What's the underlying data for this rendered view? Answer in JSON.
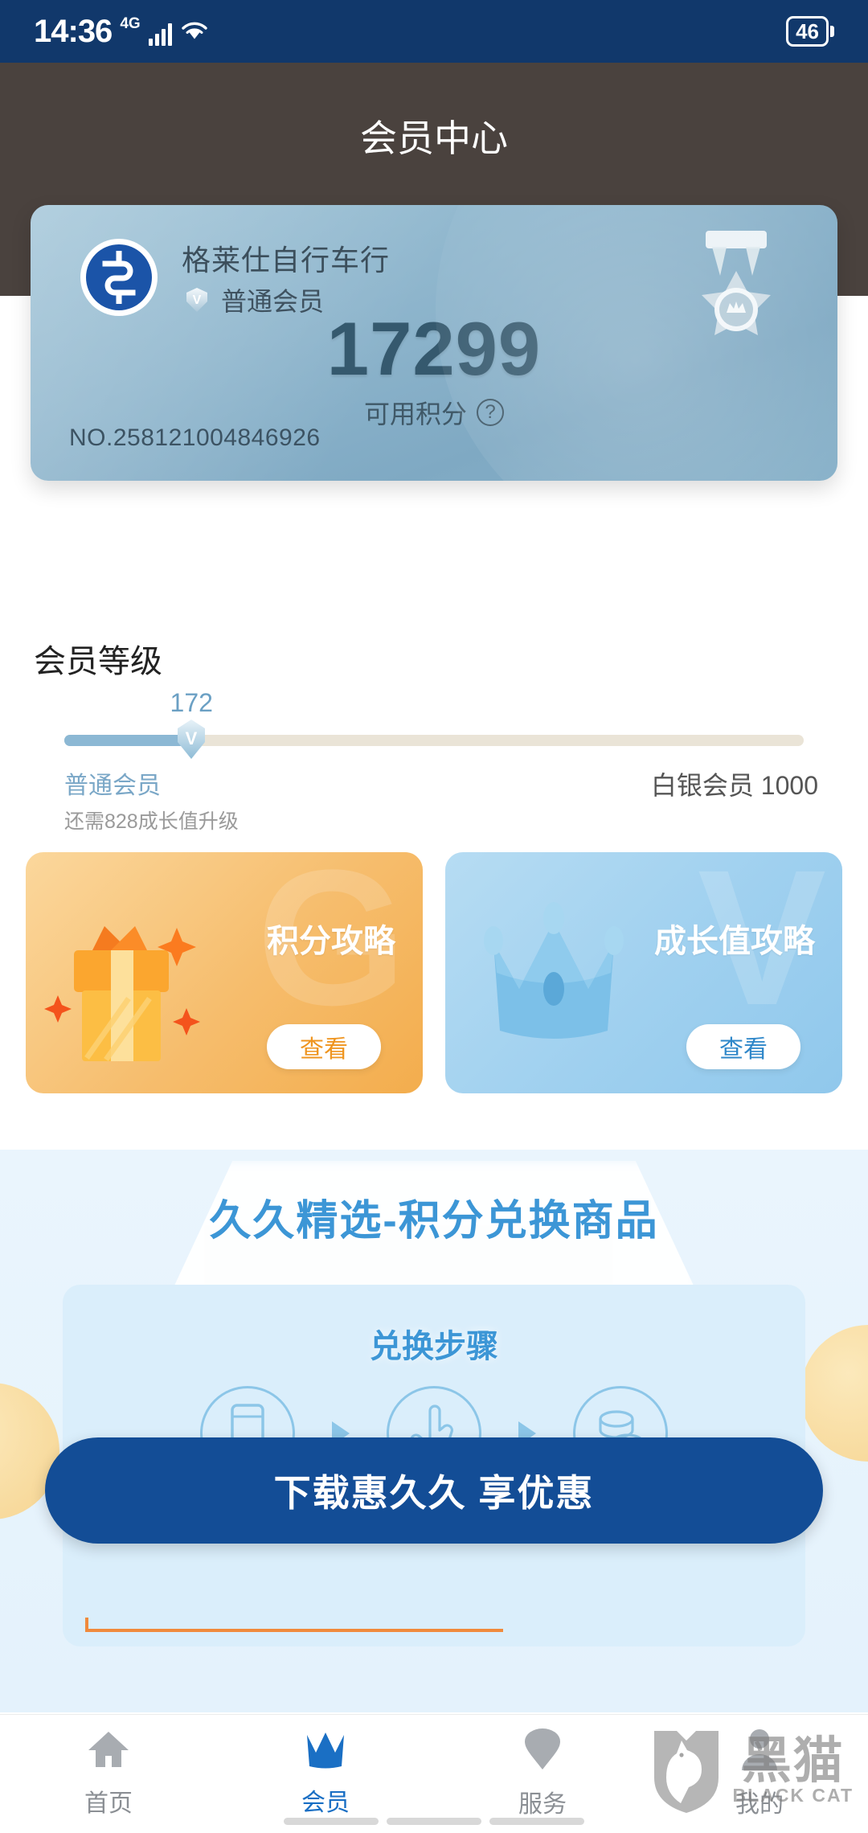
{
  "statusbar": {
    "time": "14:36",
    "network": "4G",
    "battery": "46",
    "signal_icon": "signal-bars-icon",
    "wifi_icon": "wifi-icon"
  },
  "header": {
    "title": "会员中心"
  },
  "member_card": {
    "shop_name": "格莱仕自行车行",
    "level_label": "普通会员",
    "level_badge_icon": "diamond-v-badge-icon",
    "points": "17299",
    "points_label": "可用积分",
    "help_icon": "question-mark-icon",
    "card_number": "NO.258121004846926",
    "medal_icon": "medal-ribbon-icon",
    "logo_icon": "shop-logo-icon"
  },
  "level_section": {
    "title": "会员等级",
    "growth_value": "172",
    "progress_percent": 17.2,
    "current_level": "普通会员",
    "upgrade_hint": "还需828成长值升级",
    "next_level": "白银会员 1000",
    "knob_icon": "diamond-v-knob-icon",
    "fill_color": "#8cb8d4",
    "track_color": "#eae4d7"
  },
  "promos": [
    {
      "label": "积分攻略",
      "button": "查看",
      "art_icon": "gift-box-icon",
      "ghost_char": "G",
      "accent": "#ef9520"
    },
    {
      "label": "成长值攻略",
      "button": "查看",
      "art_icon": "crown-icon",
      "ghost_char": "V",
      "accent": "#2f87c9"
    }
  ],
  "banner": {
    "title": "久久精选-积分兑换商品",
    "steps_title": "兑换步骤",
    "steps": [
      {
        "icon": "phone-icon"
      },
      {
        "icon": "tap-hand-icon"
      },
      {
        "icon": "coins-stack-icon"
      }
    ],
    "arrow_icon": "triangle-right-icon"
  },
  "cta": {
    "label": "下载惠久久 享优惠"
  },
  "tabbar": {
    "items": [
      {
        "label": "首页",
        "icon": "home-icon",
        "active": false
      },
      {
        "label": "会员",
        "icon": "crown-icon",
        "active": true
      },
      {
        "label": "服务",
        "icon": "service-pin-icon",
        "active": false
      },
      {
        "label": "我的",
        "icon": "person-icon",
        "active": false
      }
    ],
    "active_color": "#1a6fc4",
    "inactive_color": "#a8acb1"
  },
  "watermark": {
    "cn": "黑猫",
    "en": "BLACK CAT",
    "icon": "black-cat-shield-icon"
  }
}
